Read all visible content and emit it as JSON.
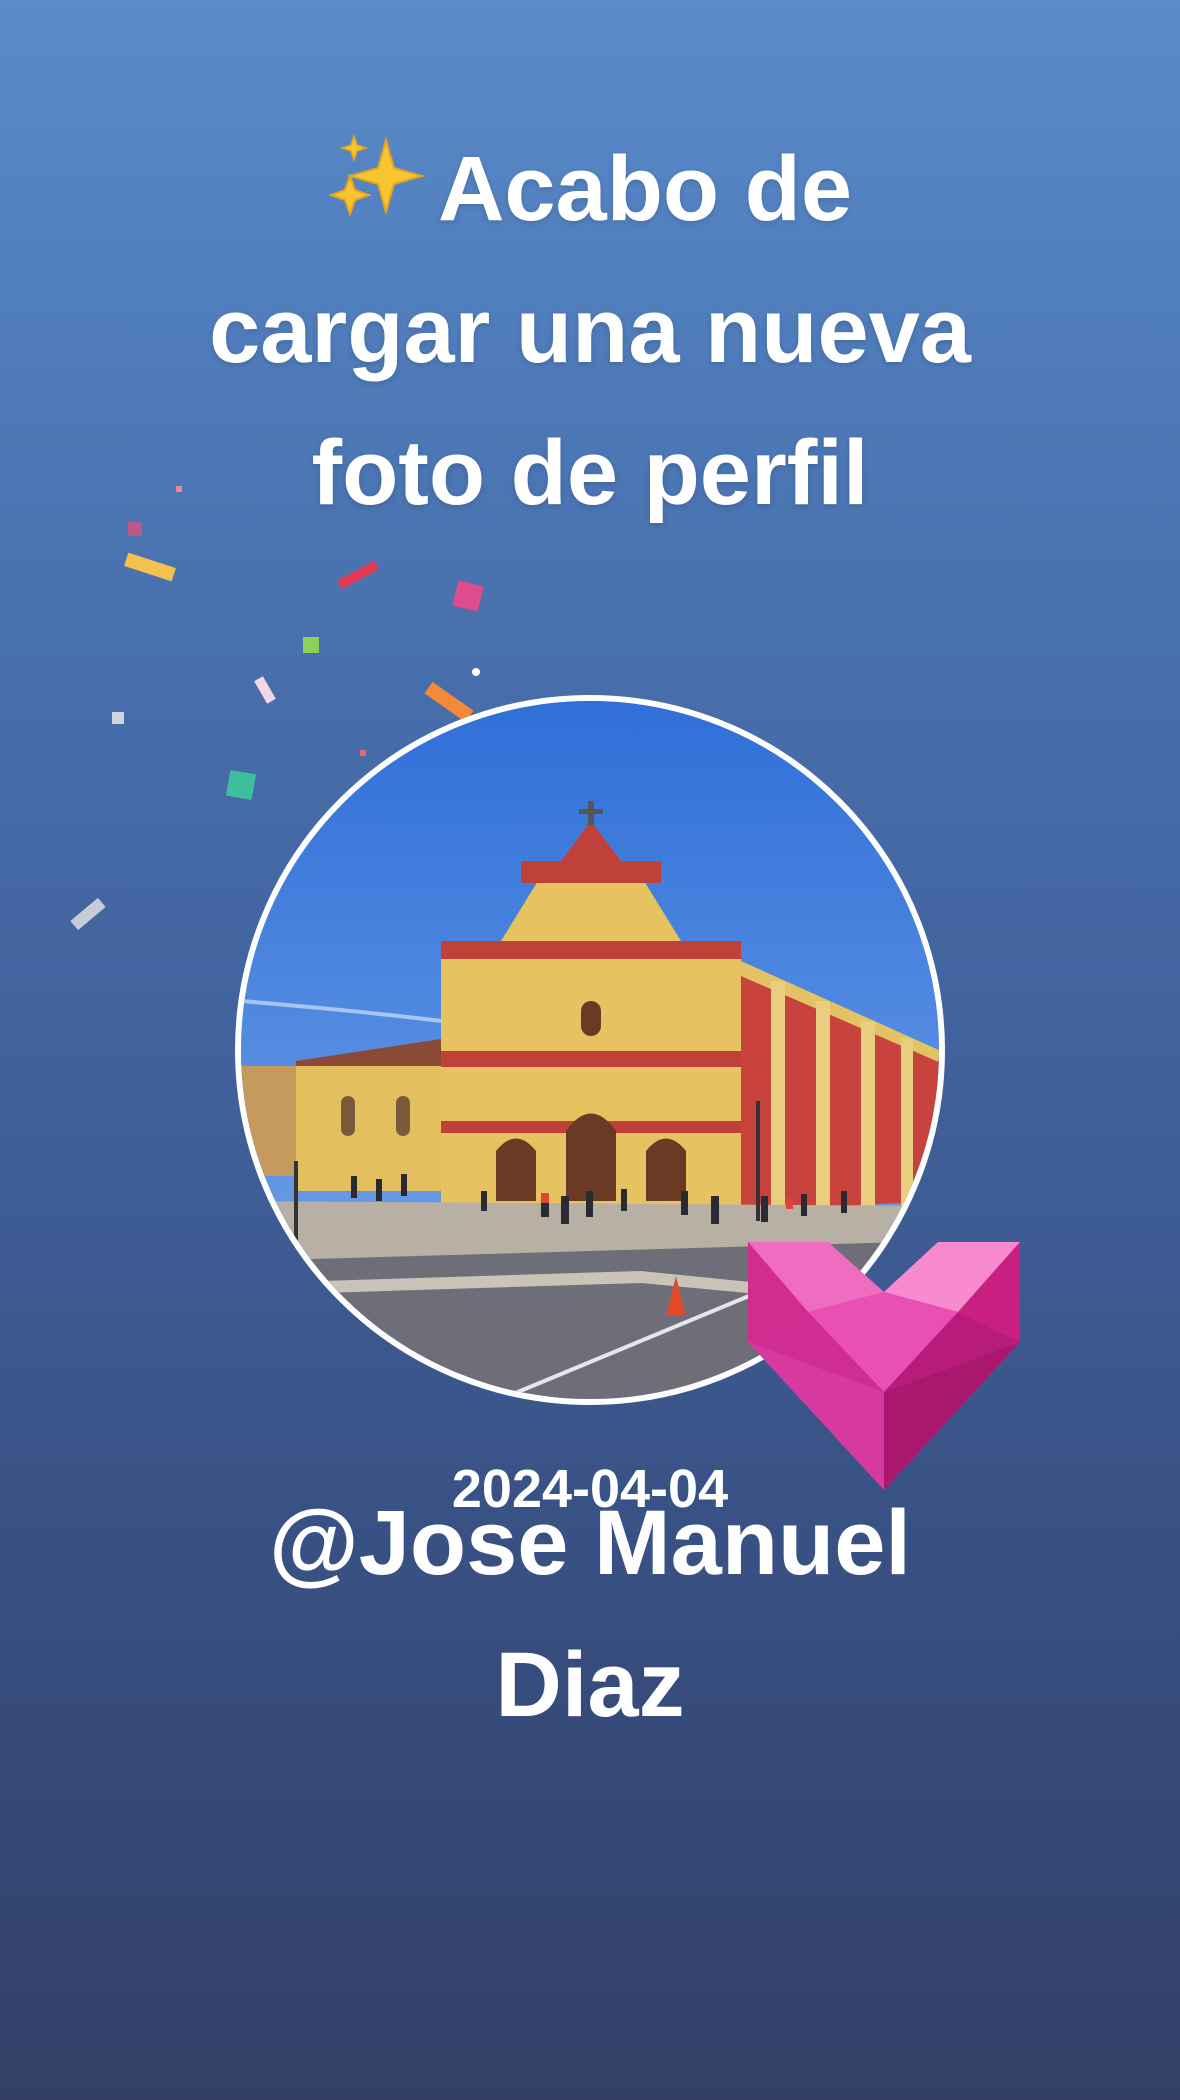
{
  "story": {
    "headline": {
      "emoji": "sparkles-icon",
      "line1": "Acabo de",
      "line2": "cargar una nueva",
      "line3": "foto de perfil"
    },
    "profile_photo": {
      "subject": "cathedral-photo"
    },
    "sticker": "heart-icon",
    "date": "2024-04-04",
    "username": {
      "line1": "@Jose Manuel",
      "line2": "Diaz"
    }
  },
  "colors": {
    "background_top": "#5a8bcb",
    "background_bottom": "#333f66",
    "text": "#ffffff",
    "heart": "#e23fa5"
  }
}
